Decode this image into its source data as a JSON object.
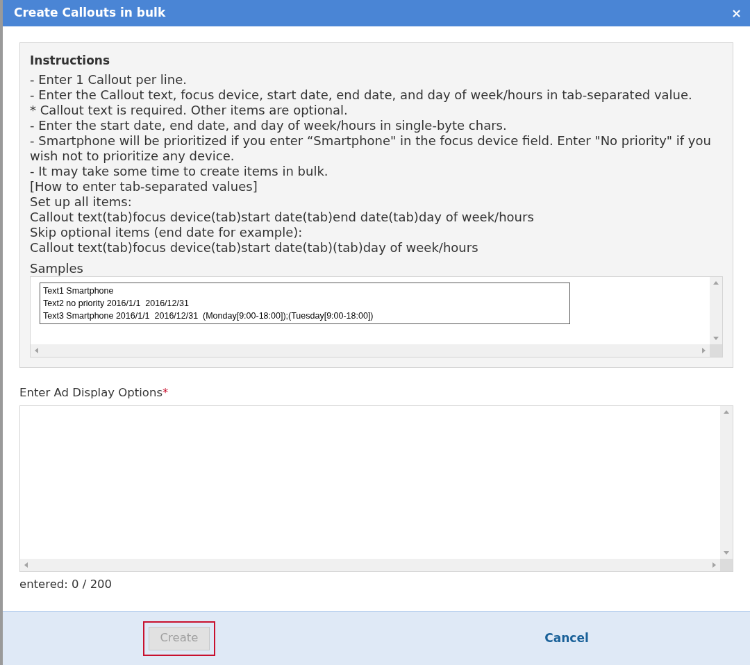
{
  "dialog": {
    "title": "Create Callouts in bulk",
    "close": "×"
  },
  "instructions": {
    "heading": "Instructions",
    "lines": [
      "- Enter 1 Callout per line.",
      "- Enter the Callout text, focus device, start date, end date, and day of week/hours in tab-separated value.",
      "* Callout text is required. Other items are optional.",
      "- Enter the start date, end date, and day of week/hours in single-byte chars.",
      "- Smartphone will be prioritized if you enter “Smartphone\" in the focus device field. Enter \"No priority\" if you wish not to prioritize any device.",
      "- It may take some time to create items in bulk.",
      "[How to enter tab-separated values]",
      "Set up all items:",
      "Callout text(tab)focus device(tab)start date(tab)end date(tab)day of week/hours",
      "Skip optional items (end date for example):",
      "Callout text(tab)focus device(tab)start date(tab)(tab)day of week/hours"
    ],
    "samples_label": "Samples",
    "samples": [
      "Text1 Smartphone",
      "Text2 no priority 2016/1/1  2016/12/31",
      "Text3 Smartphone 2016/1/1  2016/12/31  (Monday[9:00-18:00]);(Tuesday[9:00-18:00])"
    ]
  },
  "field": {
    "label": "Enter Ad Display Options",
    "required_mark": "*"
  },
  "counter": "entered: 0 / 200",
  "buttons": {
    "create": {
      "label": "Create",
      "disabled": true,
      "highlighted": true
    },
    "cancel": {
      "label": "Cancel"
    }
  }
}
